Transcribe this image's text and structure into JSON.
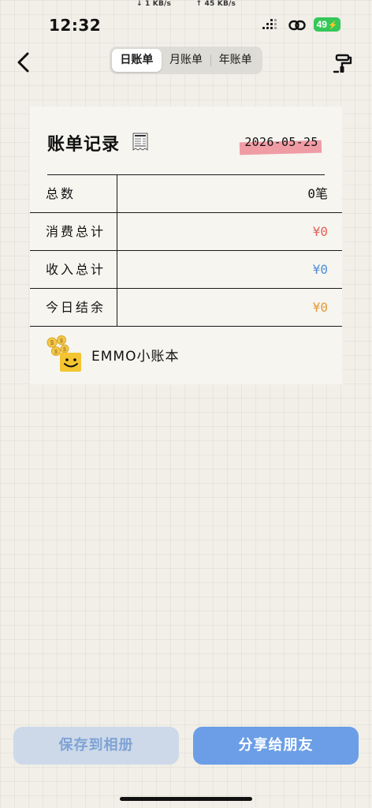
{
  "status_bar": {
    "time": "12:32",
    "download_speed": "↓ 1 KB/s",
    "upload_speed": "↑ 45 KB/s",
    "battery_level": "49",
    "battery_color": "#36c759"
  },
  "nav": {
    "back_icon": "chevron-left-icon",
    "tabs": [
      {
        "label": "日账单",
        "active": true
      },
      {
        "label": "月账单",
        "active": false
      },
      {
        "label": "年账单",
        "active": false
      }
    ],
    "brush_icon": "paint-roller-icon"
  },
  "card": {
    "title": "账单记录",
    "title_icon": "receipt-icon",
    "date": "2026-05-25",
    "tape_color": "#ee8c98",
    "rows": [
      {
        "label": "总数",
        "value": "0笔",
        "color": "#111111"
      },
      {
        "label": "消费总计",
        "value": "¥0",
        "color": "#e2625b"
      },
      {
        "label": "收入总计",
        "value": "¥0",
        "color": "#4f8fd8"
      },
      {
        "label": "今日结余",
        "value": "¥0",
        "color": "#e49a3a"
      }
    ],
    "brand_name": "EMMO小账本",
    "brand_icon": "smiley-coins-logo"
  },
  "actions": {
    "save_label": "保存到相册",
    "share_label": "分享给朋友",
    "save_bg": "#cdd9e9",
    "share_bg": "#6b9ee6"
  }
}
